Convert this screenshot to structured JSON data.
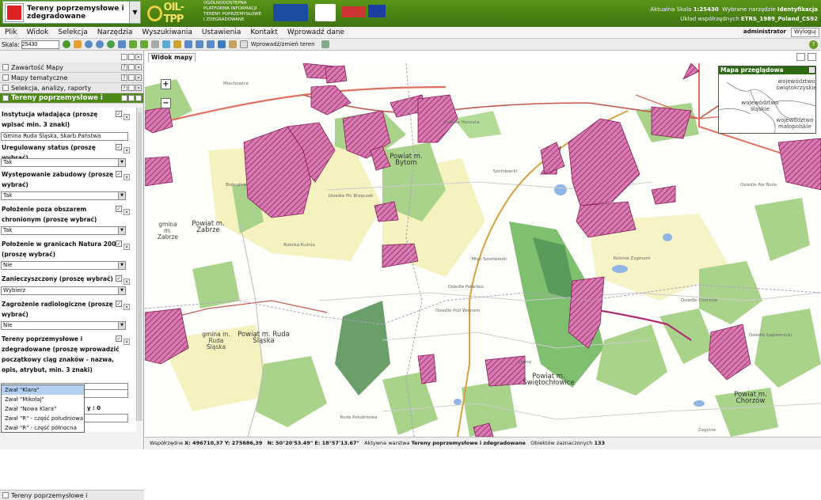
{
  "header": {
    "layer_title": "Tereny poprzemysłowe i zdegradowane",
    "logo_text": "OIL-TPP",
    "platform_lines": [
      "OGÓLNODOSTĘPNA",
      "PLATFORMA INFORMACJI",
      "TERENY POPRZEMYSŁOWE",
      "I ZDEGRADOWANE"
    ],
    "scale_label": "Aktualna Skala",
    "scale_value": "1:25430",
    "tool_label": "Wybrane narzędzie",
    "tool_value": "Identyfikacja",
    "crs_label": "Układ współrzędnych",
    "crs_value": "ETRS_1989_Poland_CS92"
  },
  "menu": {
    "items": [
      "Plik",
      "Widok",
      "Selekcja",
      "Narzędzia",
      "Wyszukiwania",
      "Ustawienia",
      "Kontakt",
      "Wprowadź dane"
    ],
    "user": "administrator",
    "logout": "Wyloguj"
  },
  "toolbar": {
    "scale_label": "Skala:",
    "scale_input": "25430",
    "input_text": "Wprowadź/zmień teren",
    "help": "?"
  },
  "sidebar": {
    "panels": [
      "Zawartość Mapy",
      "Mapy tematyczne",
      "Selekcja, analizy, raporty"
    ],
    "active_panel": "Tereny poprzemysłowe i",
    "bottom_panel": "Tereny poprzemysłowe i",
    "fields": [
      {
        "label": "Instytucja władająca (proszę wpisać min. 3 znaki)",
        "value": "Gmina Ruda Śląska, Skarb Państwa",
        "type": "text"
      },
      {
        "label": "Uregulowany status (proszę wybrać)",
        "value": "Tak",
        "type": "select"
      },
      {
        "label": "Występowanie zabudowy (proszę wybrać)",
        "value": "Tak",
        "type": "select"
      },
      {
        "label": "Położenie poza obszarem chronionym (proszę wybrać)",
        "value": "Tak",
        "type": "select"
      },
      {
        "label": "Położenie w granicach Natura 2000 (proszę wybrać)",
        "value": "Nie",
        "type": "select"
      },
      {
        "label": "Zanieczyszczony (proszę wybrać)",
        "value": "Wybierz",
        "type": "select"
      },
      {
        "label": "Zagrożenie radiologiczne (proszę wybrać)",
        "value": "Nie",
        "type": "select"
      },
      {
        "label": "Tereny poprzemysłowe i zdegradowane (proszę wprowadzić początkowy ciąg znaków - nazwa, opis, atrybut, min. 3 znaki)",
        "value": "Zwał",
        "type": "text"
      }
    ],
    "hidden_fragment": "y : 0",
    "autocomplete": [
      "Zwał \"Klara\"",
      "Zwał \"Mikołaj\"",
      "Zwał \"Nowa Klara\"",
      "Zwał \"R\" - część południowa",
      "Zwał \"R\" - część północna"
    ]
  },
  "map": {
    "tab": "Widok mapy",
    "overview_title": "Mapa przeglądowa",
    "overview_labels": [
      "województwo świętokrzyskie",
      "województwo śląskie",
      "województwo małopolskie"
    ],
    "labels": {
      "bytom": "Powiat m. Bytom",
      "zabrze": "Powiat m. Zabrze",
      "ruda": "Powiat m. Ruda Śląska",
      "gmina_zabrze": "gmina m. Zabrze",
      "gmina_ruda": "gmina m. Ruda Śląska",
      "swiet": "Powiat m. Świętochłowice",
      "chorzow": "Powiat m. Chorzów",
      "miechowice": "Miechowice",
      "szombierki": "Szombierki",
      "biskupice": "Biskupice",
      "ruda_kuznia": "Rudzka Kuźnia",
      "osiedle_fin": "Osiedle Fin Brzęczek",
      "mlyn": "Młyn Szombierki",
      "osiedle_h": "Osiedle Huncyta",
      "osiedle_p": "Osiedle Połaniec",
      "osiedle_w": "Osiedle Pod Wojnem",
      "kolonia": "Kolonia Zygmunt",
      "lipiny": "Lipiny",
      "osiedle_ch": "Osiedle Chorzów",
      "ruda_pol": "Ruda Południowa",
      "osiedle_b": "Osiedle Ale Boże",
      "osiedle_l": "Osiedle Łagiewnicki",
      "zagorze": "Zagórze"
    }
  },
  "status": {
    "coords_label": "Współrzędne",
    "x": "X: 496710,37",
    "y": "Y: 275686,39",
    "n": "N: 50°20'53.49\"",
    "e": "E: 18°57'13.67\"",
    "layer_label": "Aktywna warstwa",
    "layer_value": "Tereny poprzemysłowe i zdegradowane",
    "selected_label": "Obiektów zaznaczonych",
    "selected_value": "133"
  },
  "colors": {
    "header_green": "#4f8a17",
    "brownfield_fill": "#c8408a",
    "forest": "#a9d38a",
    "road_main": "#e07060",
    "road_secondary": "#d9a040"
  }
}
